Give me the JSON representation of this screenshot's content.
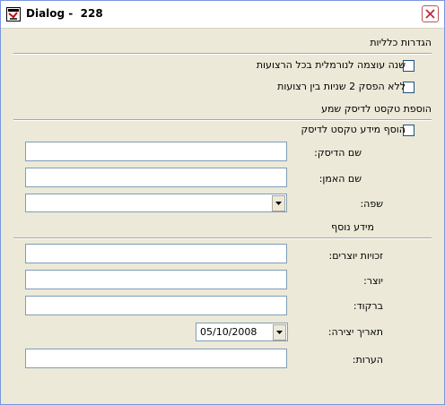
{
  "window": {
    "title": "Dialog -  228"
  },
  "general": {
    "heading": "הגדרות כלליות",
    "checkboxes": [
      {
        "label": "שנה עוצמה לנורמלית בכל הרצועות",
        "checked": false
      },
      {
        "label": "ללא הפסק 2 שניות בין רצועות",
        "checked": false
      }
    ]
  },
  "cdtext": {
    "heading": "הוספת טקסט לדיסק שמע",
    "add_checkbox": {
      "label": "הוסף מידע טקסט לדיסק",
      "checked": false
    },
    "disc_name_label": "שם הדיסק:",
    "disc_name_value": "",
    "artist_label": "שם האמן:",
    "artist_value": "",
    "language_label": "שפה:",
    "language_value": ""
  },
  "extra": {
    "heading": "מידע נוסף",
    "copyright_label": "זכויות יוצרים:",
    "copyright_value": "",
    "creator_label": "יוצר:",
    "creator_value": "",
    "barcode_label": "ברקוד:",
    "barcode_value": "",
    "date_label": "תאריך יצירה:",
    "date_value": "05/10/2008",
    "notes_label": "הערות:",
    "notes_value": ""
  },
  "icons": {
    "app": "app-icon",
    "close": "close-icon",
    "dropdown": "chevron-down-icon"
  }
}
